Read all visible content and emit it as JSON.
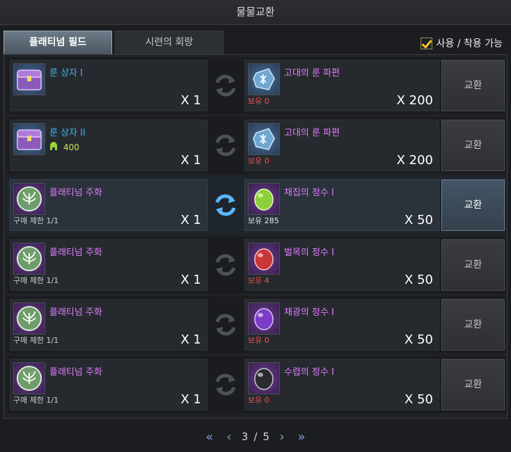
{
  "window": {
    "title": "물물교환"
  },
  "tabs": [
    {
      "label": "플래티넘 필드"
    },
    {
      "label": "시련의 회랑"
    }
  ],
  "filter": {
    "label": "사용 / 착용 가능",
    "checked": true
  },
  "rows": [
    {
      "source": {
        "name": "룬 상자 I",
        "name_color": "cyan",
        "icon": "rune-chest-icon",
        "qty": "X 1",
        "limit": "",
        "sub_value": ""
      },
      "target": {
        "name": "고대의 룬 파편",
        "icon": "rune-fragment-icon",
        "owned": "보유 0",
        "owned_color": "red",
        "qty": "X 200"
      },
      "button": "교환",
      "highlighted": false
    },
    {
      "source": {
        "name": "룬 상자 II",
        "name_color": "cyan",
        "icon": "rune-chest-icon",
        "qty": "X 1",
        "limit": "",
        "sub_value": "400"
      },
      "target": {
        "name": "고대의 룬 파편",
        "icon": "rune-fragment-icon",
        "owned": "보유 0",
        "owned_color": "red",
        "qty": "X 200"
      },
      "button": "교환",
      "highlighted": false
    },
    {
      "source": {
        "name": "플래티넘 주화",
        "name_color": "pink",
        "icon": "platinum-coin-icon",
        "qty": "X 1",
        "limit": "구매 제한 1/1",
        "sub_value": ""
      },
      "target": {
        "name": "채집의 정수 I",
        "icon": "green-essence-icon",
        "owned": "보유 285",
        "owned_color": "white",
        "qty": "X 50"
      },
      "button": "교환",
      "highlighted": true
    },
    {
      "source": {
        "name": "플래티넘 주화",
        "name_color": "pink",
        "icon": "platinum-coin-icon",
        "qty": "X 1",
        "limit": "구매 제한 1/1",
        "sub_value": ""
      },
      "target": {
        "name": "벌목의 정수 I",
        "icon": "red-essence-icon",
        "owned": "보유 4",
        "owned_color": "red",
        "qty": "X 50"
      },
      "button": "교환",
      "highlighted": false
    },
    {
      "source": {
        "name": "플래티넘 주화",
        "name_color": "pink",
        "icon": "platinum-coin-icon",
        "qty": "X 1",
        "limit": "구매 제한 1/1",
        "sub_value": ""
      },
      "target": {
        "name": "채광의 정수 I",
        "icon": "purple-essence-icon",
        "owned": "보유 0",
        "owned_color": "red",
        "qty": "X 50"
      },
      "button": "교환",
      "highlighted": false
    },
    {
      "source": {
        "name": "플래티넘 주화",
        "name_color": "pink",
        "icon": "platinum-coin-icon",
        "qty": "X 1",
        "limit": "구매 제한 1/1",
        "sub_value": ""
      },
      "target": {
        "name": "수렵의 정수 I",
        "icon": "black-essence-icon",
        "owned": "보유 0",
        "owned_color": "red",
        "qty": "X 50"
      },
      "button": "교환",
      "highlighted": false
    }
  ],
  "pager": {
    "current": "3",
    "separator": "/",
    "total": "5"
  }
}
